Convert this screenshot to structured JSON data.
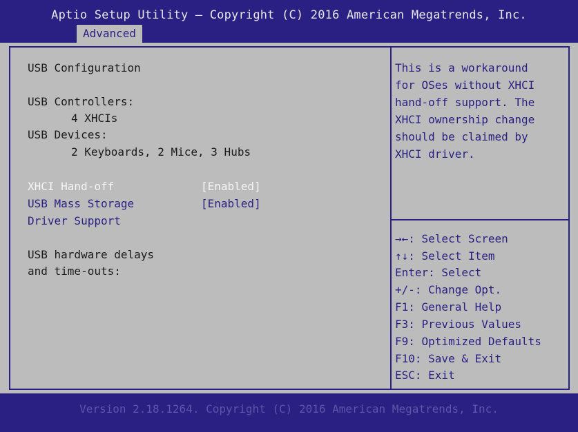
{
  "header": {
    "title": "Aptio Setup Utility – Copyright (C) 2016 American Megatrends, Inc.",
    "tab": "Advanced"
  },
  "main": {
    "section_title": "USB Configuration",
    "controllers_label": "USB Controllers:",
    "controllers_value": "4 XHCIs",
    "devices_label": "USB Devices:",
    "devices_value": "2 Keyboards, 2 Mice, 3 Hubs",
    "xhci_handoff_label": "XHCI Hand-off",
    "xhci_handoff_value": "[Enabled]",
    "mass_storage_label_1": "USB Mass Storage",
    "mass_storage_label_2": "Driver Support",
    "mass_storage_value": "[Enabled]",
    "delays_label_1": "USB hardware delays",
    "delays_label_2": "and time-outs:"
  },
  "help": {
    "lines": [
      "This is a workaround",
      "for OSes without XHCI",
      "hand-off support. The",
      "XHCI ownership change",
      "should be claimed by",
      "XHCI driver."
    ]
  },
  "keys": [
    "→←: Select Screen",
    "↑↓: Select Item",
    "Enter: Select",
    "+/-: Change Opt.",
    "F1: General Help",
    "F3: Previous Values",
    "F9: Optimized Defaults",
    "F10: Save & Exit",
    "ESC: Exit"
  ],
  "footer": {
    "text": "Version 2.18.1264. Copyright (C) 2016 American Megatrends, Inc."
  },
  "colors": {
    "bar_blue": "#2a1f82",
    "panel_gray": "#bcbcbc",
    "selected_white": "#f5f5f5"
  }
}
